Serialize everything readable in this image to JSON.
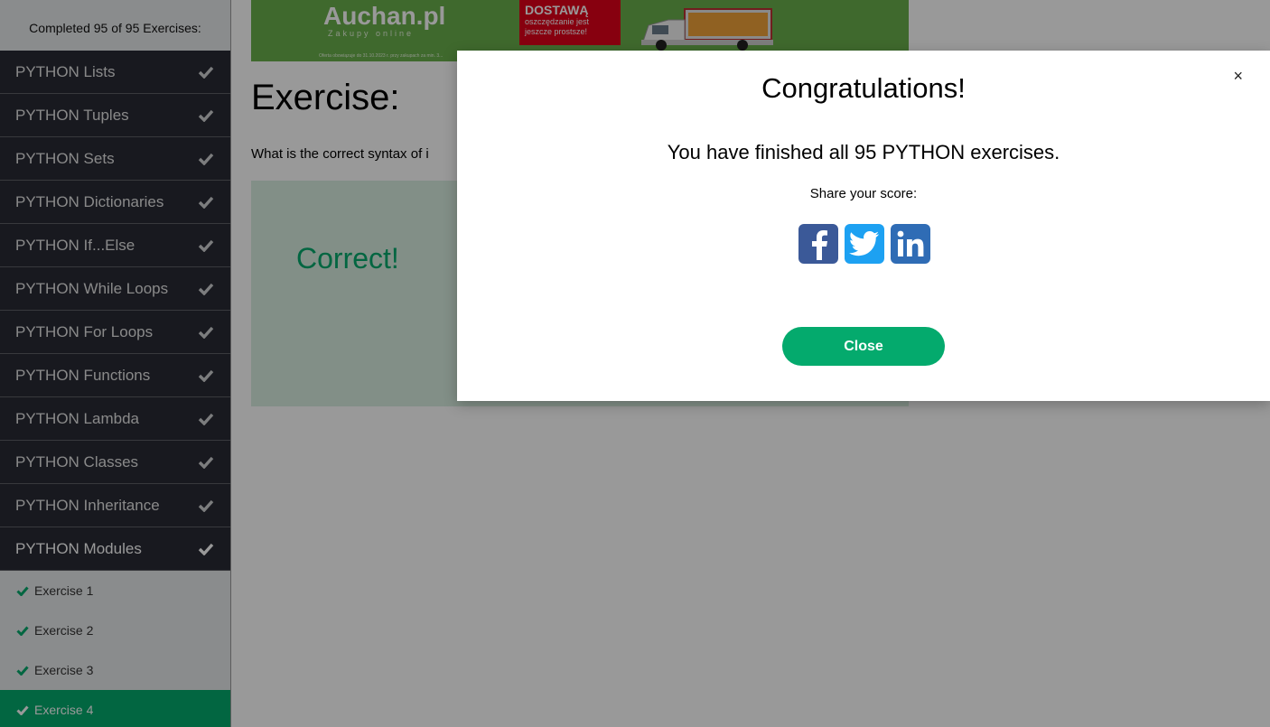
{
  "sidebar": {
    "progress": "Completed 95 of 95 Exercises:",
    "topics": [
      {
        "label": "PYTHON Lists"
      },
      {
        "label": "PYTHON Tuples"
      },
      {
        "label": "PYTHON Sets"
      },
      {
        "label": "PYTHON Dictionaries"
      },
      {
        "label": "PYTHON If...Else"
      },
      {
        "label": "PYTHON While Loops"
      },
      {
        "label": "PYTHON For Loops"
      },
      {
        "label": "PYTHON Functions"
      },
      {
        "label": "PYTHON Lambda"
      },
      {
        "label": "PYTHON Classes"
      },
      {
        "label": "PYTHON Inheritance"
      },
      {
        "label": "PYTHON Modules"
      }
    ],
    "exercises": [
      {
        "label": "Exercise 1"
      },
      {
        "label": "Exercise 2"
      },
      {
        "label": "Exercise 3"
      },
      {
        "label": "Exercise 4"
      }
    ]
  },
  "ad": {
    "brand": "Auchan.pl",
    "tagline": "Zakupy online",
    "promo_headline": "DOSTAWĄ",
    "promo_text": "oszczędzanie jest jeszcze prostsze!",
    "fine_print": "Oferta obowiązuje do 31.10.2023 r. przy zakupach za min. 3..."
  },
  "main": {
    "title": "Exercise:",
    "question": "What is the correct syntax of i",
    "result": "Correct!"
  },
  "modal": {
    "title": "Congratulations!",
    "message": "You have finished all 95 PYTHON exercises.",
    "share_label": "Share your score:",
    "close_x": "×",
    "close_button": "Close"
  },
  "colors": {
    "accent": "#04aa6d",
    "sidebar_dark": "#282a35",
    "facebook": "#3b5998",
    "twitter": "#1da1f2",
    "linkedin": "#2f6cb5"
  }
}
